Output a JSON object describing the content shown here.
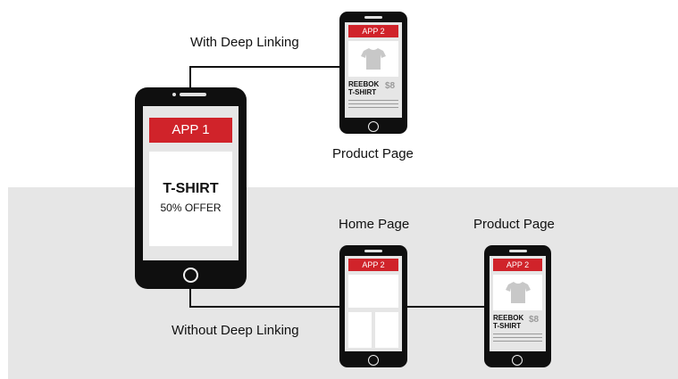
{
  "colors": {
    "accent_red": "#d0232a",
    "phone_body": "#0f0f0f",
    "band": "#e6e6e6",
    "shirt": "#c8c8c8"
  },
  "labels": {
    "with_deep_linking": "With Deep Linking",
    "without_deep_linking": "Without Deep Linking",
    "product_page_top": "Product Page",
    "home_page": "Home Page",
    "product_page_bottom": "Product Page"
  },
  "phone_main": {
    "header": "APP 1",
    "offer_title": "T-SHIRT",
    "offer_subtitle": "50% OFFER"
  },
  "phone_product_top": {
    "header": "APP 2",
    "product_name_line1": "REEBOK",
    "product_name_line2": "T-SHIRT",
    "price": "$8",
    "icon": "tshirt-icon"
  },
  "phone_home": {
    "header": "APP 2"
  },
  "phone_product_bottom": {
    "header": "APP 2",
    "product_name_line1": "REEBOK",
    "product_name_line2": "T-SHIRT",
    "price": "$8",
    "icon": "tshirt-icon"
  }
}
